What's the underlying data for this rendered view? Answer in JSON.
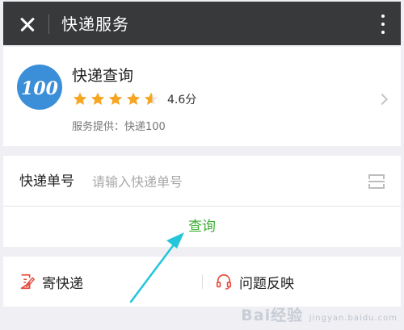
{
  "topbar": {
    "title": "快递服务"
  },
  "service": {
    "logo_text": "100",
    "name": "快递查询",
    "rating": "4.6分",
    "rating_value": 4.6,
    "rating_max": 5,
    "provider": "服务提供：快递100"
  },
  "form": {
    "number_label": "快递单号",
    "number_placeholder": "请输入快递单号",
    "number_value": "",
    "query_label": "查询"
  },
  "actions": {
    "send_label": "寄快递",
    "feedback_label": "问题反映"
  },
  "watermark": {
    "brand": "Bai经验",
    "url": "jingyan.baidu.com"
  },
  "colors": {
    "topbar_bg": "#37393b",
    "star": "#f5a623",
    "query_green": "#3cb034",
    "logo_blue": "#3b8ed8",
    "icon_red": "#e74c3c",
    "annotation_arrow": "#26c6da"
  },
  "icons": [
    "close-icon",
    "more-icon",
    "chevron-right-icon",
    "scan-icon",
    "edit-icon",
    "headset-icon"
  ]
}
